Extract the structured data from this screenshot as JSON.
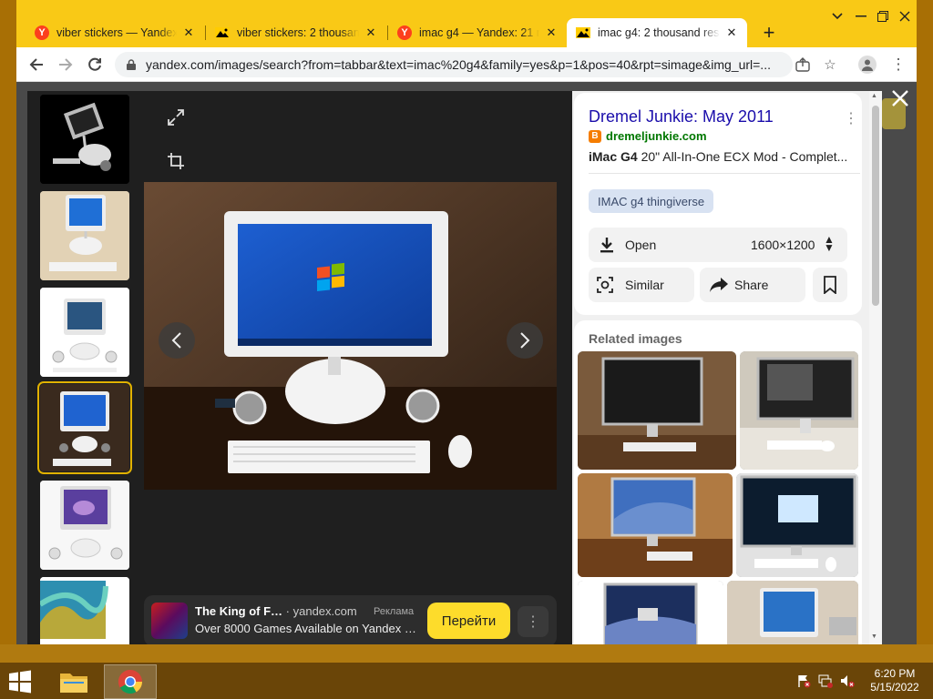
{
  "browser": {
    "tabs": [
      {
        "title": "viber stickers — Yandex: ",
        "favicon": "yandex-icon"
      },
      {
        "title": "viber stickers: 2 thousand",
        "favicon": "image-icon"
      },
      {
        "title": "imac g4 — Yandex: 21 m",
        "favicon": "yandex-icon"
      },
      {
        "title": "imac g4: 2 thousand resu",
        "favicon": "image-icon",
        "active": true
      }
    ],
    "new_tab": "+",
    "url": "yandex.com/images/search?from=tabbar&text=imac%20g4&family=yes&p=1&pos=40&rpt=simage&img_url=..."
  },
  "viewer": {
    "ad": {
      "title": "The King of F…",
      "domain": "· yandex.com",
      "badge": "Реклама",
      "subtitle": "Over 8000 Games Available on Yandex …",
      "button": "Перейти"
    }
  },
  "panel": {
    "source_title": "Dremel Junkie: May 2011",
    "source_domain": "dremeljunkie.com",
    "desc_bold": "iMac G4",
    "desc_rest": " 20\" All-In-One ECX Mod - Complet...",
    "tag": "IMAC g4 thingiverse",
    "open_label": "Open",
    "size": "1600×1200",
    "similar_label": "Similar",
    "share_label": "Share",
    "related_title": "Related images"
  },
  "taskbar": {
    "time": "6:20 PM",
    "date": "5/15/2022"
  },
  "colors": {
    "tab_bar": "#f9c916",
    "accent_yellow": "#fddc2b",
    "link_blue": "#1a0dab",
    "domain_green": "#007700"
  }
}
